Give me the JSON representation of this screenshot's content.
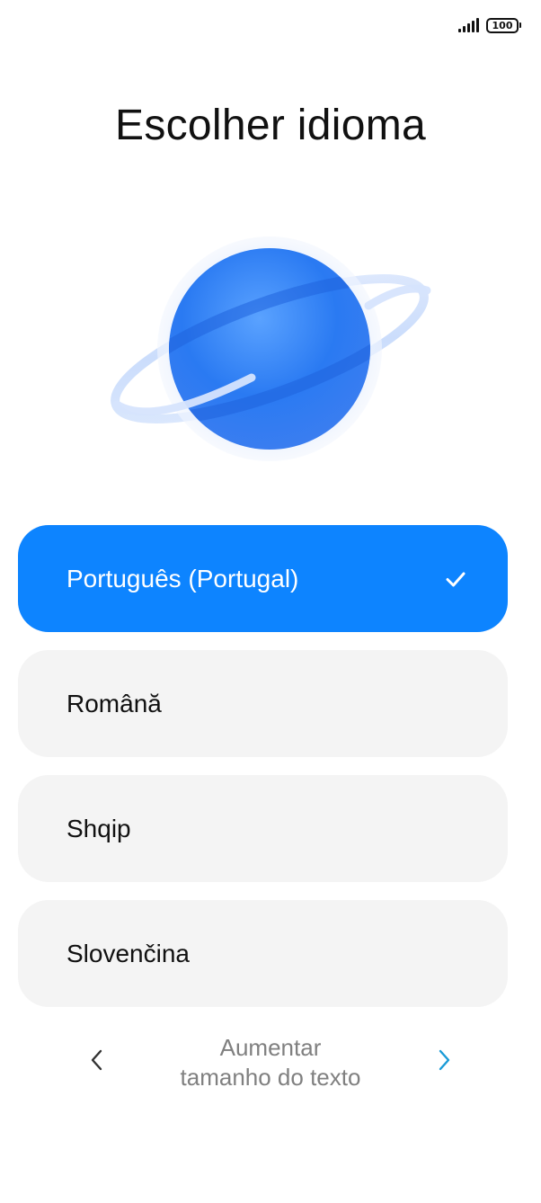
{
  "status_bar": {
    "signal_icon": "signal-bars-icon",
    "battery_level": "100",
    "battery_icon": "battery-icon"
  },
  "title": "Escolher idioma",
  "illustration_icon": "planet-icon",
  "languages": [
    {
      "label": "Português (Portugal)",
      "selected": true
    },
    {
      "label": "Română",
      "selected": false
    },
    {
      "label": "Shqip",
      "selected": false
    },
    {
      "label": "Slovenčina",
      "selected": false
    }
  ],
  "text_size": {
    "line1": "Aumentar",
    "line2": "tamanho do texto",
    "prev_icon": "chevron-left-icon",
    "next_icon": "chevron-right-icon"
  },
  "colors": {
    "accent": "#0d84ff",
    "item_background": "#f4f4f4",
    "next_chevron": "#1a9bd7",
    "secondary_text": "#808080"
  }
}
